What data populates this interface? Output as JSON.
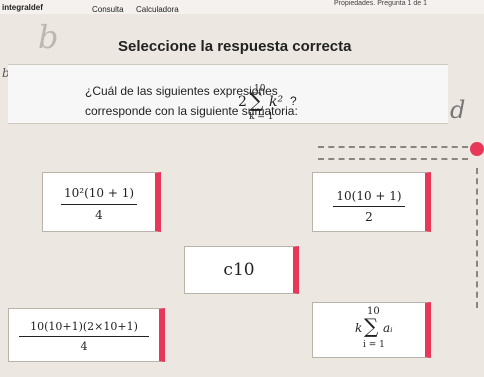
{
  "header": {
    "left_title": "integraldef",
    "tab_consulta": "Consulta",
    "tab_calculadora": "Calculadora",
    "progress": "Propiedades. Pregunta 1 de 1"
  },
  "background": {
    "letter_b": "b",
    "letter_b_small": "b",
    "letter_d": "d"
  },
  "question": {
    "heading": "Seleccione la respuesta correcta",
    "line1": "¿Cuál de las siguientes expresiones",
    "line2": "corresponde con la siguiente sumatoria:",
    "sum_coef": "2",
    "sum_upper": "10",
    "sum_lower": "k = 1",
    "sum_var": "k²",
    "qmark": "?"
  },
  "options": [
    {
      "numerator": "10²(10 + 1)",
      "denominator": "4"
    },
    {
      "numerator": "10(10 + 1)",
      "denominator": "2"
    },
    {
      "text": "c10"
    },
    {
      "numerator": "10(10+1)(2×10+1)",
      "denominator": "4"
    },
    {
      "upper": "10",
      "coef": "k",
      "var": "aᵢ",
      "lower": "i = 1"
    }
  ],
  "colors": {
    "accent": "#e8385a",
    "card": "#ffffff",
    "background": "#ece7e1"
  }
}
